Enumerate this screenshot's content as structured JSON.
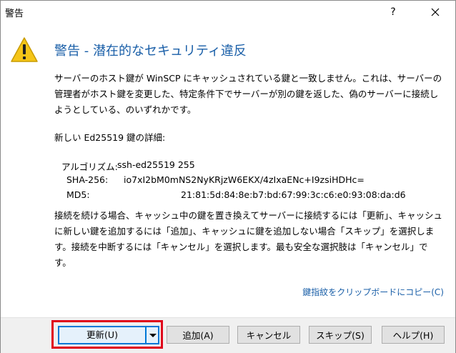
{
  "window": {
    "title": "警告",
    "help_glyph": "?"
  },
  "heading": "警告 - 潜在的なセキュリティ違反",
  "paragraph1": "サーバーのホスト鍵が WinSCP にキャッシュされている鍵と一致しません。これは、サーバーの管理者がホスト鍵を変更した、特定条件下でサーバーが別の鍵を返した、偽のサーバーに接続しようとしている、のいずれかです。",
  "paragraph2": "新しい Ed25519 鍵の詳細:",
  "fingerprints": {
    "algo_label": "アルゴリズム:",
    "algo_value": "ssh-ed25519 255",
    "sha_label": "SHA-256:",
    "sha_value": "io7xI2bM0mNS2NyKRjzW6EKX/4zIxaENc+I9zsiHDHc=",
    "md5_label": "MD5:",
    "md5_value": "21:81:5d:84:8e:b7:bd:67:99:3c:c6:e0:93:08:da:d6"
  },
  "paragraph3": "接続を続ける場合、キャッシュ中の鍵を置き換えてサーバーに接続するには「更新」、キャッシュに新しい鍵を追加するには「追加」、キャッシュに鍵を追加しない場合「スキップ」を選択します。接続を中断するには「キャンセル」を選択します。最も安全な選択肢は「キャンセル」です。",
  "copy_link": "鍵指紋をクリップボードにコピー(C)",
  "buttons": {
    "update": "更新(U)",
    "add": "追加(A)",
    "cancel": "キャンセル",
    "skip": "スキップ(S)",
    "help": "ヘルプ(H)"
  },
  "colors": {
    "heading": "#1a5fa8",
    "highlight": "#e0001a",
    "focus": "#0078d7",
    "warning": "#f5c518"
  },
  "icons": [
    "warning-icon",
    "close-icon",
    "help-icon",
    "dropdown-arrow-icon"
  ]
}
